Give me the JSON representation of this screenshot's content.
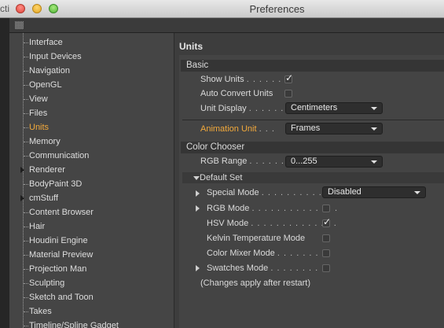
{
  "window": {
    "title": "Preferences",
    "background_window_text": "cti"
  },
  "sidebar": {
    "items": [
      {
        "label": "Interface",
        "expandable": false
      },
      {
        "label": "Input Devices",
        "expandable": false
      },
      {
        "label": "Navigation",
        "expandable": false
      },
      {
        "label": "OpenGL",
        "expandable": false
      },
      {
        "label": "View",
        "expandable": false
      },
      {
        "label": "Files",
        "expandable": false
      },
      {
        "label": "Units",
        "expandable": false,
        "active": true
      },
      {
        "label": "Memory",
        "expandable": false
      },
      {
        "label": "Communication",
        "expandable": false
      },
      {
        "label": "Renderer",
        "expandable": true
      },
      {
        "label": "BodyPaint 3D",
        "expandable": false
      },
      {
        "label": "cmStuff",
        "expandable": true
      },
      {
        "label": "Content Browser",
        "expandable": false
      },
      {
        "label": "Hair",
        "expandable": false
      },
      {
        "label": "Houdini Engine",
        "expandable": false
      },
      {
        "label": "Material Preview",
        "expandable": false
      },
      {
        "label": "Projection Man",
        "expandable": false
      },
      {
        "label": "Sculpting",
        "expandable": false
      },
      {
        "label": "Sketch and Toon",
        "expandable": false
      },
      {
        "label": "Takes",
        "expandable": false
      },
      {
        "label": "Timeline/Spline Gadget",
        "expandable": false
      }
    ]
  },
  "units": {
    "panel_title": "Units",
    "basic": {
      "header": "Basic",
      "show_units": {
        "label": "Show Units",
        "dots": ". . . . . . .",
        "checked": true
      },
      "auto_convert_units": {
        "label": "Auto Convert Units",
        "checked": false
      },
      "unit_display": {
        "label": "Unit Display",
        "dots": ". . . . . .",
        "value": "Centimeters"
      },
      "animation_unit": {
        "label": "Animation Unit",
        "dots": ". . .",
        "value": "Frames"
      }
    },
    "color_chooser": {
      "header": "Color Chooser",
      "rgb_range": {
        "label": "RGB Range",
        "dots": ". . . . . . . .",
        "value": "0...255"
      },
      "default_set": {
        "header": "Default Set",
        "special_mode": {
          "label": "Special Mode",
          "dots": ". . . . . . . . . . .",
          "value": "Disabled"
        },
        "rgb_mode": {
          "label": "RGB Mode",
          "dots": ". . . . . . . . . . . . . .",
          "checked": false
        },
        "hsv_mode": {
          "label": "HSV Mode",
          "dots": ". . . . . . . . . . . . . .",
          "checked": true
        },
        "kelvin_mode": {
          "label": "Kelvin Temperature Mode",
          "checked": false
        },
        "color_mixer_mode": {
          "label": "Color Mixer Mode",
          "dots": ". . . . . . .",
          "checked": false
        },
        "swatches_mode": {
          "label": "Swatches Mode",
          "dots": ". . . . . . . . .",
          "checked": false
        }
      },
      "note": "(Changes apply after restart)"
    }
  },
  "colors": {
    "accent_orange": "#f2a93b",
    "panel": "#444444",
    "sidebar": "#454545"
  },
  "icons": {
    "check": "✓"
  }
}
